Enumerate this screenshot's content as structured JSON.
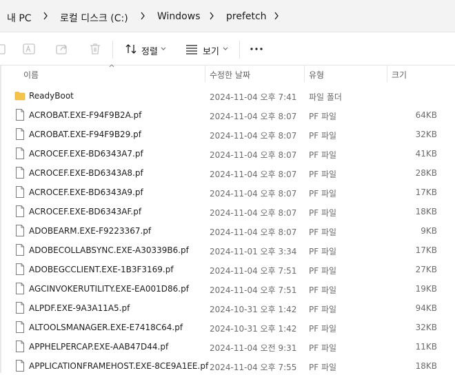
{
  "breadcrumb": [
    "내 PC",
    "로컬 디스크 (C:)",
    "Windows",
    "prefetch"
  ],
  "toolbar": {
    "sort_label": "정렬",
    "view_label": "보기"
  },
  "columns": {
    "name": "이름",
    "date": "수정한 날짜",
    "type": "유형",
    "size": "크기"
  },
  "files": [
    {
      "name": "ReadyBoot",
      "date": "2024-11-04 오후 7:41",
      "type": "파일 폴더",
      "size": "",
      "icon": "folder-icon"
    },
    {
      "name": "ACROBAT.EXE-F94F9B2A.pf",
      "date": "2024-11-04 오후 8:07",
      "type": "PF 파일",
      "size": "64KB",
      "icon": "file-icon"
    },
    {
      "name": "ACROBAT.EXE-F94F9B29.pf",
      "date": "2024-11-04 오후 8:07",
      "type": "PF 파일",
      "size": "32KB",
      "icon": "file-icon"
    },
    {
      "name": "ACROCEF.EXE-BD6343A7.pf",
      "date": "2024-11-04 오후 8:07",
      "type": "PF 파일",
      "size": "41KB",
      "icon": "file-icon"
    },
    {
      "name": "ACROCEF.EXE-BD6343A8.pf",
      "date": "2024-11-04 오후 8:07",
      "type": "PF 파일",
      "size": "28KB",
      "icon": "file-icon"
    },
    {
      "name": "ACROCEF.EXE-BD6343A9.pf",
      "date": "2024-11-04 오후 8:07",
      "type": "PF 파일",
      "size": "17KB",
      "icon": "file-icon"
    },
    {
      "name": "ACROCEF.EXE-BD6343AF.pf",
      "date": "2024-11-04 오후 8:07",
      "type": "PF 파일",
      "size": "18KB",
      "icon": "file-icon"
    },
    {
      "name": "ADOBEARM.EXE-F9223367.pf",
      "date": "2024-11-04 오후 8:07",
      "type": "PF 파일",
      "size": "9KB",
      "icon": "file-icon"
    },
    {
      "name": "ADOBECOLLABSYNC.EXE-A30339B6.pf",
      "date": "2024-11-01 오후 3:34",
      "type": "PF 파일",
      "size": "17KB",
      "icon": "file-icon"
    },
    {
      "name": "ADOBEGCCLIENT.EXE-1B3F3169.pf",
      "date": "2024-11-04 오후 7:51",
      "type": "PF 파일",
      "size": "27KB",
      "icon": "file-icon"
    },
    {
      "name": "AGCINVOKERUTILITY.EXE-EA001D86.pf",
      "date": "2024-11-04 오후 7:51",
      "type": "PF 파일",
      "size": "19KB",
      "icon": "file-icon"
    },
    {
      "name": "ALPDF.EXE-9A3A11A5.pf",
      "date": "2024-10-31 오후 1:42",
      "type": "PF 파일",
      "size": "94KB",
      "icon": "file-icon"
    },
    {
      "name": "ALTOOLSMANAGER.EXE-E7418C64.pf",
      "date": "2024-10-31 오후 1:42",
      "type": "PF 파일",
      "size": "32KB",
      "icon": "file-icon"
    },
    {
      "name": "APPHELPERCAP.EXE-AAB47D44.pf",
      "date": "2024-11-04 오전 9:31",
      "type": "PF 파일",
      "size": "11KB",
      "icon": "file-icon"
    },
    {
      "name": "APPLICATIONFRAMEHOST.EXE-8CE9A1EE.pf",
      "date": "2024-11-04 오후 7:55",
      "type": "PF 파일",
      "size": "18KB",
      "icon": "file-icon"
    }
  ],
  "colors": {
    "folder": "#f4c34a",
    "accent": "#0067c0"
  }
}
